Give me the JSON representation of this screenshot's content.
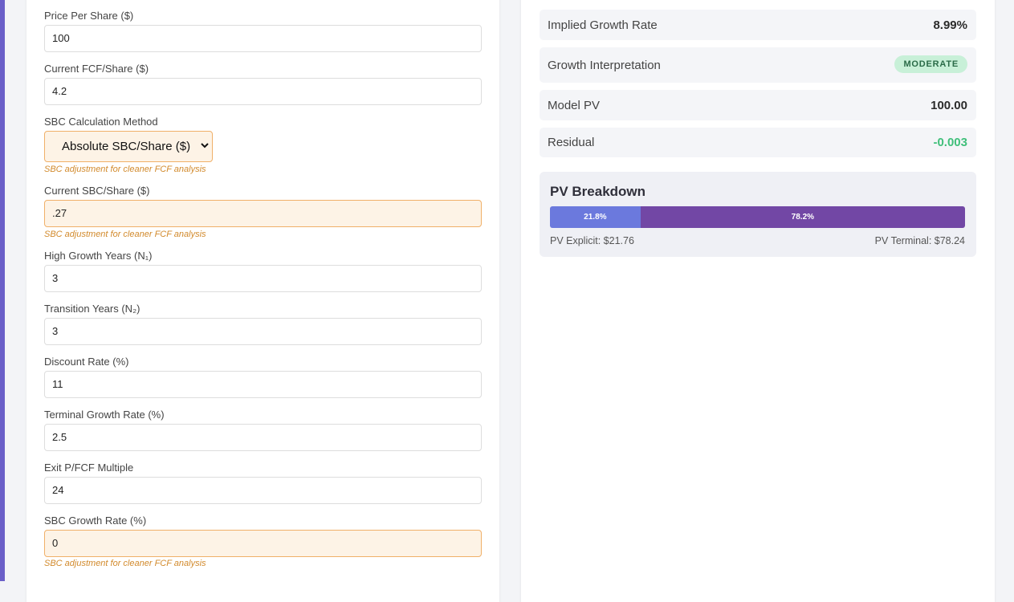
{
  "inputs": {
    "price_per_share": {
      "label": "Price Per Share ($)",
      "value": "100"
    },
    "current_fcf": {
      "label": "Current FCF/Share ($)",
      "value": "4.2"
    },
    "sbc_method": {
      "label": "SBC Calculation Method",
      "value": "Absolute SBC/Share ($)",
      "note": "SBC adjustment for cleaner FCF analysis"
    },
    "current_sbc": {
      "label": "Current SBC/Share ($)",
      "value": ".27",
      "note": "SBC adjustment for cleaner FCF analysis"
    },
    "high_growth_years": {
      "label": "High Growth Years (N₁)",
      "value": "3"
    },
    "transition_years": {
      "label": "Transition Years (N₂)",
      "value": "3"
    },
    "discount_rate": {
      "label": "Discount Rate (%)",
      "value": "11"
    },
    "terminal_growth": {
      "label": "Terminal Growth Rate (%)",
      "value": "2.5"
    },
    "exit_multiple": {
      "label": "Exit P/FCF Multiple",
      "value": "24"
    },
    "sbc_growth": {
      "label": "SBC Growth Rate (%)",
      "value": "0",
      "note": "SBC adjustment for cleaner FCF analysis"
    }
  },
  "results": {
    "implied_growth": {
      "label": "Implied Growth Rate",
      "value": "8.99%"
    },
    "interpretation": {
      "label": "Growth Interpretation",
      "badge": "MODERATE"
    },
    "model_pv": {
      "label": "Model PV",
      "value": "100.00"
    },
    "residual": {
      "label": "Residual",
      "value": "-0.003"
    }
  },
  "breakdown": {
    "title": "PV Breakdown",
    "explicit_pct": "21.8%",
    "terminal_pct": "78.2%",
    "explicit_fraction": 0.218,
    "explicit_label": "PV Explicit: $21.76",
    "terminal_label": "PV Terminal: $78.24"
  },
  "colors": {
    "accent": "#6a5fc8",
    "explicit_bar": "#6b79dd",
    "terminal_bar": "#7247a5",
    "sbc_highlight": "#fdf3e6",
    "sbc_note": "#d28a2c",
    "badge_bg": "#c8f0d8",
    "residual": "#3fbf7a"
  }
}
